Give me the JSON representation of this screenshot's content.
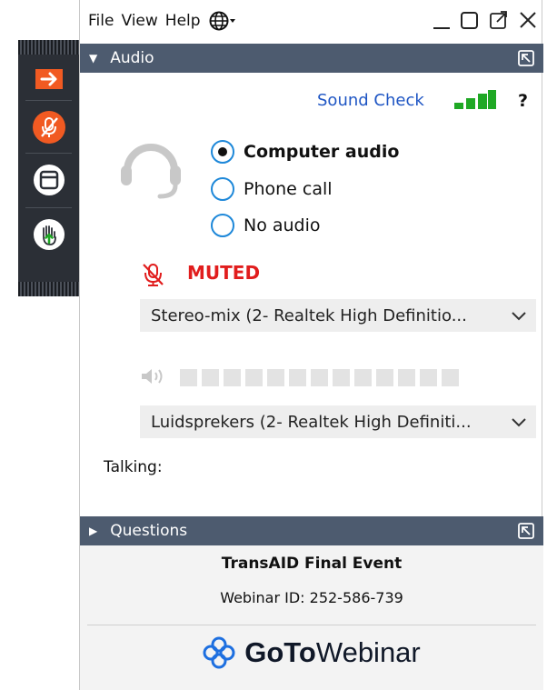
{
  "menu": {
    "file": "File",
    "view": "View",
    "help": "Help"
  },
  "audio_section": {
    "title": "Audio",
    "sound_check": "Sound Check",
    "help_label": "?",
    "options": [
      {
        "label": "Computer audio",
        "selected": true
      },
      {
        "label": "Phone call",
        "selected": false
      },
      {
        "label": "No audio",
        "selected": false
      }
    ],
    "muted_label": "MUTED",
    "microphone_device": "Stereo-mix (2- Realtek High Definitio...",
    "speaker_device": "Luidsprekers (2- Realtek High Definiti...",
    "talking_label": "Talking:",
    "speaker_level": 0
  },
  "questions_section": {
    "title": "Questions"
  },
  "event": {
    "title": "TransAID Final Event",
    "webinar_id": "Webinar ID: 252-586-739"
  },
  "brand": {
    "bold": "GoTo",
    "regular": "Webinar"
  },
  "colors": {
    "section_bar": "#4d5b6f",
    "accent_blue": "#1f56c4",
    "muted_red": "#e11d1d",
    "signal_green": "#1fa824",
    "strip_orange": "#f15a22"
  }
}
